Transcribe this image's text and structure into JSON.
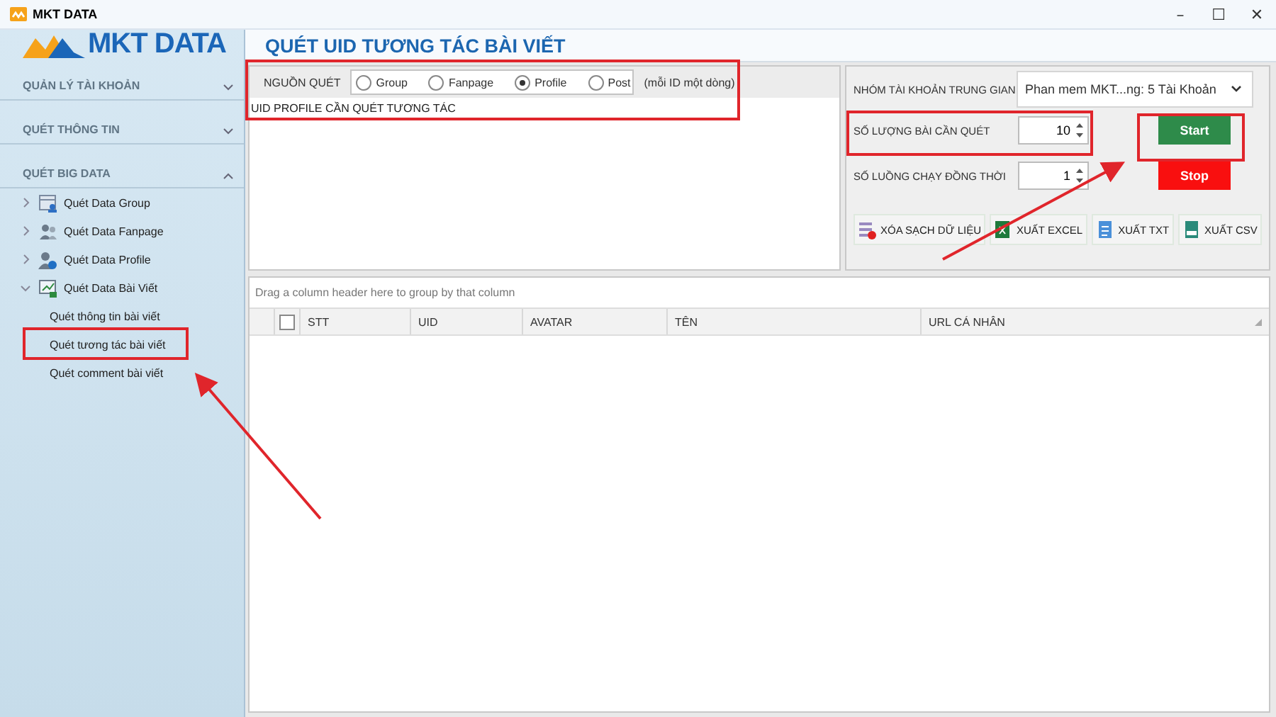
{
  "window": {
    "title": "MKT DATA",
    "logo_text": "MKT DATA",
    "controls": [
      "–",
      "☐",
      "✕"
    ]
  },
  "sidebar": {
    "sections": [
      {
        "label": "QUẢN LÝ TÀI KHOẢN",
        "expanded": false
      },
      {
        "label": "QUÉT THÔNG TIN",
        "expanded": false
      },
      {
        "label": "QUÉT BIG DATA",
        "expanded": true,
        "items": [
          {
            "label": "Quét Data Group",
            "expanded": false
          },
          {
            "label": "Quét Data Fanpage",
            "expanded": false
          },
          {
            "label": "Quét Data Profile",
            "expanded": false
          },
          {
            "label": "Quét Data Bài Viết",
            "expanded": true,
            "children": [
              {
                "label": "Quét thông tin bài viết"
              },
              {
                "label": "Quét tương tác bài viết"
              },
              {
                "label": "Quét comment bài viết"
              }
            ]
          }
        ]
      }
    ]
  },
  "page_title": "QUÉT UID TƯƠNG TÁC BÀI VIẾT",
  "source": {
    "label": "NGUỒN QUÉT",
    "options": [
      {
        "label": "Group",
        "selected": false
      },
      {
        "label": "Fanpage",
        "selected": false
      },
      {
        "label": "Profile",
        "selected": true
      },
      {
        "label": "Post",
        "selected": false
      }
    ],
    "note": "(mỗi ID một dòng)",
    "input_label": "UID PROFILE CẦN QUÉT TƯƠNG TÁC"
  },
  "settings": {
    "account_group": {
      "label": "NHÓM TÀI KHOẢN TRUNG GIAN",
      "value": "Phan mem MKT...ng: 5 Tài Khoản"
    },
    "post_count": {
      "label": "SỐ LƯỢNG BÀI CẦN QUÉT",
      "value": "10"
    },
    "threads": {
      "label": "SỐ LUỒNG CHẠY ĐỒNG THỜI",
      "value": "1"
    },
    "start": "Start",
    "stop": "Stop",
    "actions": [
      "XÓA SẠCH DỮ LIỆU",
      "XUẤT EXCEL",
      "XUẤT TXT",
      "XUẤT CSV"
    ]
  },
  "grid": {
    "select_all_checked": false,
    "group_hint": "Drag a column header here to group by that column",
    "columns": [
      "STT",
      "UID",
      "AVATAR",
      "TÊN",
      "URL CÁ NHÂN"
    ]
  }
}
